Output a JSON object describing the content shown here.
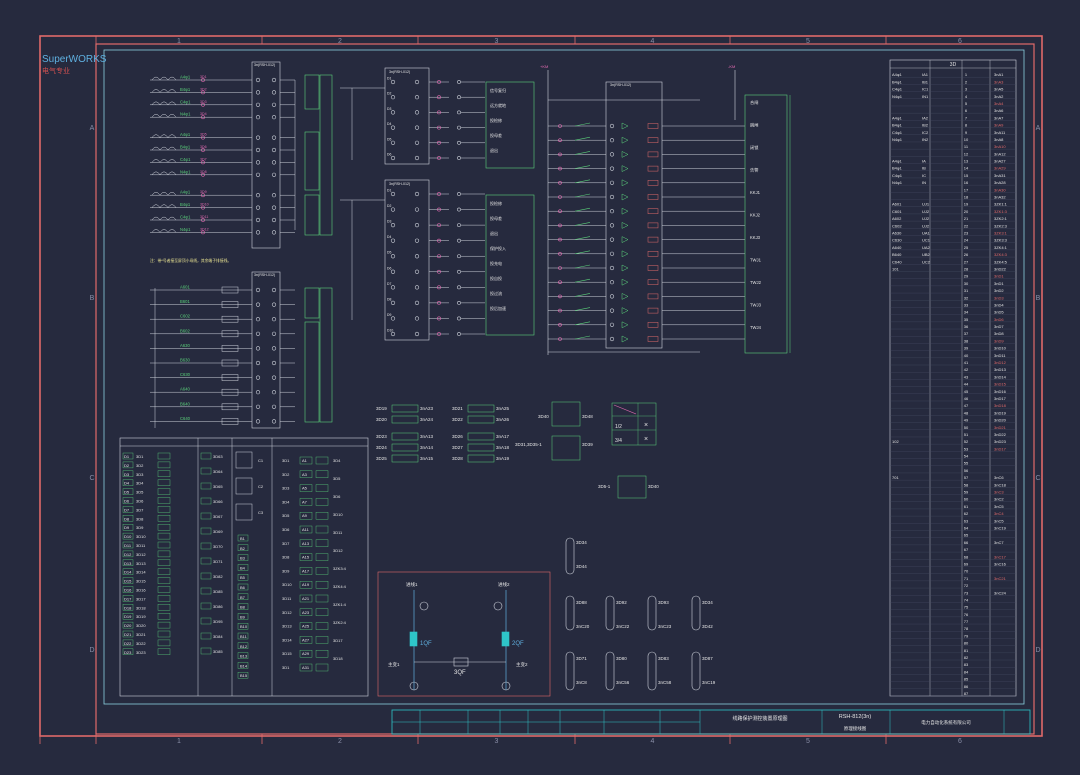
{
  "app": {
    "brand": "SuperWORKS",
    "brand_sub": "电气专业"
  },
  "frame": {
    "col_numbers": [
      "1",
      "2",
      "3",
      "4",
      "5",
      "6"
    ],
    "row_letters": [
      "A",
      "B",
      "C",
      "D"
    ]
  },
  "diagram": {
    "plug_block_title": "3n(RSH-012)",
    "note": "注：带*号者接至屏顶小母线，其余端子排接线。",
    "breaker_left": "1QF",
    "breaker_right": "2QF",
    "bus_tie": "3QF",
    "incoming_left": "进线1",
    "incoming_right": "进线2",
    "tx_left": "主变1",
    "tx_right": "主变2",
    "relay_grid": [
      [
        "3D19",
        "3nA23",
        "3D21",
        "3nA25"
      ],
      [
        "3D20",
        "3nA24",
        "3D22",
        "3nA26"
      ],
      [
        "3D23",
        "3nA13",
        "3D26",
        "3nA17"
      ],
      [
        "3D24",
        "3nA14",
        "3D27",
        "3nA18"
      ],
      [
        "3D25",
        "3nA15",
        "3D28",
        "3nA19"
      ]
    ],
    "relay_mid": [
      "3D40",
      "3D48",
      "3D31,3D35-1",
      "3D39",
      "3D5-1",
      "3D40"
    ],
    "switch_table": [
      "1/2",
      "3/4"
    ],
    "current_terms": [
      "A4φ1",
      "B4φ1",
      "C4φ1",
      "N4φ1",
      "A4φ1",
      "B4φ1",
      "C4φ1",
      "N4φ1",
      "A4φ1",
      "B4φ1",
      "C4φ1",
      "N4φ1"
    ],
    "voltage_terms": [
      "A601",
      "B601",
      "C602",
      "B602",
      "A630",
      "B630",
      "C630",
      "A640",
      "B640",
      "C640"
    ],
    "input_labels": [
      "信号复归",
      "远方就地",
      "投检修",
      "投母差",
      "退出",
      "保护投入",
      "投充电",
      "投自投",
      "投过流",
      "投后加速"
    ],
    "output_labels": [
      "合闸",
      "跳闸",
      "闭锁",
      "告警",
      "KKJ1",
      "KKJ2",
      "KKJ3",
      "TWJ1",
      "TWJ2",
      "TWJ3",
      "TWJ4"
    ],
    "bottom_terms_a": [
      "3D88",
      "3D92",
      "3D93",
      "3D34"
    ],
    "bottom_terms_b": [
      "3nC20",
      "3nC22",
      "3nC23",
      "3D42"
    ],
    "bottom_terms_c": [
      "3D71",
      "3D80",
      "3D83",
      "3D87"
    ],
    "bottom_terms_d": [
      "3nC8",
      "3nC56",
      "3nC58",
      "3nC19"
    ],
    "single_terms": [
      "3D34",
      "3D44"
    ],
    "terminal_cols": {
      "c1": [
        "3D1",
        "3D2",
        "3D3",
        "3D4",
        "3D5",
        "3D6",
        "3D7",
        "3D8",
        "3D9",
        "3D10",
        "3D11",
        "3D12",
        "3D13",
        "3D14",
        "3D15",
        "3D16",
        "3D17",
        "3D18",
        "3D19",
        "3D20",
        "3D21",
        "3D22",
        "3D23"
      ],
      "c2": [
        "3D63",
        "3D64",
        "3D65",
        "3D66",
        "3D67",
        "3D69",
        "3D70",
        "3D71",
        "3D82",
        "3D85",
        "3D86",
        "3D95",
        "3D84",
        "3D85"
      ],
      "c3": [
        "3D1",
        "3D2",
        "3D3",
        "3D4",
        "3D5",
        "3D6",
        "3D7",
        "3D8",
        "3D9",
        "3D10",
        "3D11",
        "3D12",
        "3D13",
        "3D14",
        "3D15"
      ],
      "c4": [
        "A1",
        "A3",
        "A5",
        "A7",
        "A9",
        "A11",
        "A13",
        "A15",
        "A17",
        "A19",
        "A21",
        "A23",
        "A25",
        "A27",
        "A29",
        "A31"
      ],
      "c5": [
        "3D4",
        "3D5",
        "3D6",
        "3D10",
        "3D11",
        "3D12",
        "3ZK3:4",
        "3ZK4:4",
        "3ZK1:4",
        "3ZK2:4",
        "3D17",
        "3D18"
      ]
    }
  },
  "right_table": {
    "header": "3D",
    "rows": [
      [
        "A4φ1",
        "IA1",
        "1",
        "3nA1"
      ],
      [
        "B4φ1",
        "IB1",
        "2",
        "3nA3"
      ],
      [
        "C4φ1",
        "IC1",
        "3",
        "3nA5"
      ],
      [
        "N4φ1",
        "IN1",
        "4",
        "3nA2"
      ],
      [
        "",
        "",
        "5",
        "3nA4"
      ],
      [
        "",
        "",
        "6",
        "3nA6"
      ],
      [
        "A4φ1",
        "IA2",
        "7",
        "3nA7"
      ],
      [
        "B4φ1",
        "IB2",
        "8",
        "3nA9"
      ],
      [
        "C4φ1",
        "IC2",
        "9",
        "3nA11"
      ],
      [
        "N4φ1",
        "IN2",
        "10",
        "3nA8"
      ],
      [
        "",
        "",
        "11",
        "3nA10"
      ],
      [
        "",
        "",
        "12",
        "3nA12"
      ],
      [
        "A4φ1",
        "IA",
        "13",
        "3nA27"
      ],
      [
        "B4φ1",
        "IB",
        "14",
        "3nA29"
      ],
      [
        "C4φ1",
        "IC",
        "15",
        "3nA31"
      ],
      [
        "N4φ1",
        "IN",
        "16",
        "3nA28"
      ],
      [
        "",
        "",
        "17",
        "3nA30"
      ],
      [
        "",
        "",
        "18",
        "3nA32"
      ],
      [
        "A601",
        "UJ1",
        "19",
        "3ZK1:1"
      ],
      [
        "C601",
        "UJ2",
        "20",
        "3ZK1:3"
      ],
      [
        "A602",
        "UJ2",
        "21",
        "3ZK2:1"
      ],
      [
        "C602",
        "UJ2",
        "22",
        "3ZK2:3"
      ],
      [
        "A630",
        "UA1",
        "23",
        "3ZK3:1"
      ],
      [
        "C630",
        "UC1",
        "24",
        "3ZK3:3"
      ],
      [
        "A640",
        "UA2",
        "25",
        "3ZK4:1"
      ],
      [
        "B640",
        "UB2",
        "26",
        "3ZK4:3"
      ],
      [
        "C640",
        "UC2",
        "27",
        "3ZK4:5"
      ],
      [
        "101",
        "",
        "28",
        "3nD22"
      ],
      [
        "",
        "",
        "29",
        "3nD1"
      ],
      [
        "",
        "",
        "30",
        "3nD1"
      ],
      [
        "",
        "",
        "31",
        "3nD2"
      ],
      [
        "",
        "",
        "32",
        "3nD3"
      ],
      [
        "",
        "",
        "33",
        "3nD4"
      ],
      [
        "",
        "",
        "34",
        "3nD5"
      ],
      [
        "",
        "",
        "35",
        "3nD6"
      ],
      [
        "",
        "",
        "36",
        "3nD7"
      ],
      [
        "",
        "",
        "37",
        "3nD8"
      ],
      [
        "",
        "",
        "38",
        "3nD9"
      ],
      [
        "",
        "",
        "39",
        "3nD10"
      ],
      [
        "",
        "",
        "40",
        "3nD11"
      ],
      [
        "",
        "",
        "41",
        "3nD12"
      ],
      [
        "",
        "",
        "42",
        "3nD13"
      ],
      [
        "",
        "",
        "43",
        "3nD14"
      ],
      [
        "",
        "",
        "44",
        "3nD15"
      ],
      [
        "",
        "",
        "45",
        "3nD16"
      ],
      [
        "",
        "",
        "46",
        "3nD17"
      ],
      [
        "",
        "",
        "47",
        "3nD18"
      ],
      [
        "",
        "",
        "48",
        "3nD19"
      ],
      [
        "",
        "",
        "49",
        "3nD20"
      ],
      [
        "",
        "",
        "50",
        "3nD21"
      ],
      [
        "",
        "",
        "51",
        "3nD22"
      ],
      [
        "102",
        "",
        "52",
        "3nD23"
      ],
      [
        "",
        "",
        "53",
        "3nD17"
      ],
      [
        "",
        "",
        "54",
        ""
      ],
      [
        "",
        "",
        "55",
        ""
      ],
      [
        "",
        "",
        "56",
        ""
      ],
      [
        "701",
        "",
        "57",
        "3nC6"
      ],
      [
        "",
        "",
        "58",
        "3nC18"
      ],
      [
        "",
        "",
        "59",
        "3nC3"
      ],
      [
        "",
        "",
        "60",
        "3nC2"
      ],
      [
        "",
        "",
        "61",
        "3nC5"
      ],
      [
        "",
        "",
        "62",
        "3nC4"
      ],
      [
        "",
        "",
        "63",
        "3nC5"
      ],
      [
        "",
        "",
        "64",
        "3nC19"
      ],
      [
        "",
        "",
        "65",
        ""
      ],
      [
        "",
        "",
        "66",
        "3nC7"
      ],
      [
        "",
        "",
        "67",
        ""
      ],
      [
        "",
        "",
        "68",
        "3nC17"
      ],
      [
        "",
        "",
        "69",
        "3nC16"
      ],
      [
        "",
        "",
        "70",
        ""
      ],
      [
        "",
        "",
        "71",
        "3nC21"
      ],
      [
        "",
        "",
        "72",
        ""
      ],
      [
        "",
        "",
        "73",
        "3nC24"
      ],
      [
        "",
        "",
        "74",
        ""
      ],
      [
        "",
        "",
        "75",
        ""
      ],
      [
        "",
        "",
        "76",
        ""
      ],
      [
        "",
        "",
        "77",
        ""
      ],
      [
        "",
        "",
        "78",
        ""
      ],
      [
        "",
        "",
        "79",
        ""
      ],
      [
        "",
        "",
        "80",
        ""
      ],
      [
        "",
        "",
        "81",
        ""
      ],
      [
        "",
        "",
        "82",
        ""
      ],
      [
        "",
        "",
        "83",
        ""
      ],
      [
        "",
        "",
        "84",
        ""
      ],
      [
        "",
        "",
        "85",
        ""
      ],
      [
        "",
        "",
        "86",
        ""
      ],
      [
        "",
        "",
        "87",
        ""
      ]
    ]
  },
  "title_block": {
    "model": "RSH-812(3n)",
    "drawing_title": "线路保护测控装置原理图",
    "sub_title": "原理接线图",
    "company": "电力自动化系统有限公司"
  }
}
